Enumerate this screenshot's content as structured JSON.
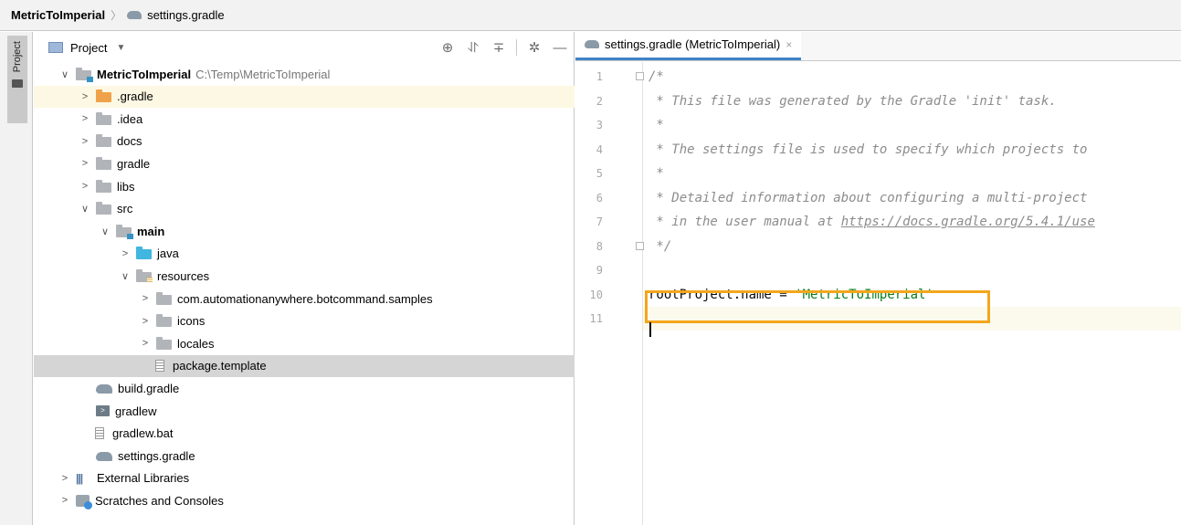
{
  "breadcrumb": {
    "project": "MetricToImperial",
    "file": "settings.gradle"
  },
  "stripe": {
    "label": "Project"
  },
  "project_panel": {
    "title": "Project",
    "tools": [
      "locate-icon",
      "expand-all-icon",
      "collapse-all-icon",
      "gear-icon",
      "minimize-icon"
    ],
    "tree": [
      {
        "label": "MetricToImperial",
        "path": "C:\\Temp\\MetricToImperial",
        "icon": "module-folder",
        "depth": 0,
        "expanded": true,
        "bold": true
      },
      {
        "label": ".gradle",
        "icon": "orange-folder",
        "depth": 1,
        "expanded": false,
        "highlight": true
      },
      {
        "label": ".idea",
        "icon": "folder",
        "depth": 1,
        "expanded": false
      },
      {
        "label": "docs",
        "icon": "folder",
        "depth": 1,
        "expanded": false
      },
      {
        "label": "gradle",
        "icon": "folder",
        "depth": 1,
        "expanded": false
      },
      {
        "label": "libs",
        "icon": "folder",
        "depth": 1,
        "expanded": false
      },
      {
        "label": "src",
        "icon": "folder",
        "depth": 1,
        "expanded": true
      },
      {
        "label": "main",
        "icon": "module-folder",
        "depth": 2,
        "expanded": true,
        "bold": true
      },
      {
        "label": "java",
        "icon": "blue-folder",
        "depth": 3,
        "expanded": false
      },
      {
        "label": "resources",
        "icon": "resources-folder",
        "depth": 3,
        "expanded": true
      },
      {
        "label": "com.automationanywhere.botcommand.samples",
        "icon": "folder",
        "depth": 4,
        "expanded": false
      },
      {
        "label": "icons",
        "icon": "folder",
        "depth": 4,
        "expanded": false
      },
      {
        "label": "locales",
        "icon": "folder",
        "depth": 4,
        "expanded": false
      },
      {
        "label": "package.template",
        "icon": "text-file",
        "depth": 4,
        "leaf": true,
        "selected": true
      },
      {
        "label": "build.gradle",
        "icon": "gradle-file",
        "depth": 1,
        "leaf": true
      },
      {
        "label": "gradlew",
        "icon": "shell-file",
        "depth": 1,
        "leaf": true
      },
      {
        "label": "gradlew.bat",
        "icon": "text-file",
        "depth": 1,
        "leaf": true
      },
      {
        "label": "settings.gradle",
        "icon": "gradle-file",
        "depth": 1,
        "leaf": true
      },
      {
        "label": "External Libraries",
        "icon": "libraries",
        "depth": 0,
        "expanded": false
      },
      {
        "label": "Scratches and Consoles",
        "icon": "scratches",
        "depth": 0,
        "expanded": false
      }
    ]
  },
  "editor": {
    "tab_label": "settings.gradle (MetricToImperial)",
    "lines": [
      {
        "num": "1",
        "segments": [
          {
            "t": "/*",
            "c": "comment"
          }
        ]
      },
      {
        "num": "2",
        "segments": [
          {
            "t": " * This file was generated by the Gradle 'init' task.",
            "c": "comment"
          }
        ]
      },
      {
        "num": "3",
        "segments": [
          {
            "t": " *",
            "c": "comment"
          }
        ]
      },
      {
        "num": "4",
        "segments": [
          {
            "t": " * The settings file is used to specify which projects to ",
            "c": "comment"
          }
        ]
      },
      {
        "num": "5",
        "segments": [
          {
            "t": " *",
            "c": "comment"
          }
        ]
      },
      {
        "num": "6",
        "segments": [
          {
            "t": " * Detailed information about configuring a multi-project ",
            "c": "comment"
          }
        ]
      },
      {
        "num": "7",
        "segments": [
          {
            "t": " * in the user manual at ",
            "c": "comment"
          },
          {
            "t": "https://docs.gradle.org/5.4.1/use",
            "c": "comment link"
          }
        ]
      },
      {
        "num": "8",
        "segments": [
          {
            "t": " */",
            "c": "comment"
          }
        ]
      },
      {
        "num": "9",
        "segments": []
      },
      {
        "num": "10",
        "segments": [
          {
            "t": "rootProject.name = ",
            "c": "plain"
          },
          {
            "t": "'MetricToImperial'",
            "c": "str"
          }
        ]
      },
      {
        "num": "11",
        "segments": [],
        "current": true
      }
    ]
  },
  "colors": {
    "accent": "#4083c9",
    "highlight_box": "#f3a61c",
    "string": "#067d17",
    "comment": "#8c8c8c"
  }
}
